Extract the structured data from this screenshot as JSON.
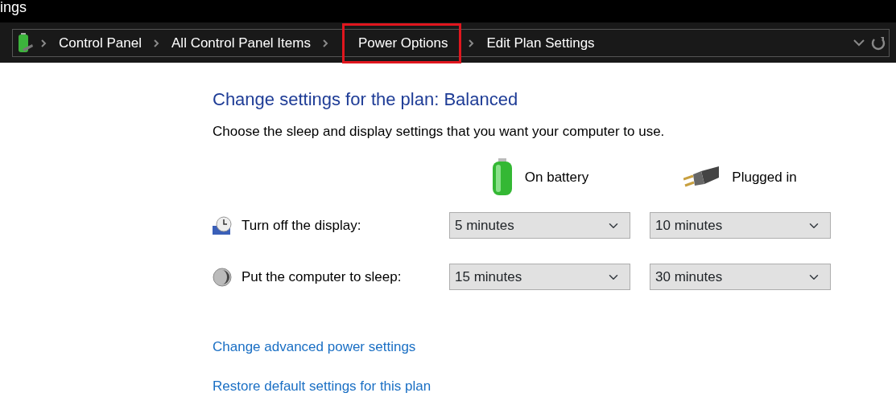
{
  "window": {
    "title": "ings"
  },
  "breadcrumb": [
    {
      "label": "Control Panel",
      "highlighted": false
    },
    {
      "label": "All Control Panel Items",
      "highlighted": false
    },
    {
      "label": "Power Options",
      "highlighted": true
    },
    {
      "label": "Edit Plan Settings",
      "highlighted": false
    }
  ],
  "heading": "Change settings for the plan: Balanced",
  "subheading": "Choose the sleep and display settings that you want your computer to use.",
  "columns": [
    {
      "kind": "battery",
      "label": "On battery"
    },
    {
      "kind": "plug",
      "label": "Plugged in"
    }
  ],
  "settings": [
    {
      "kind": "display",
      "label": "Turn off the display:",
      "values": [
        "5 minutes",
        "10 minutes"
      ]
    },
    {
      "kind": "sleep",
      "label": "Put the computer to sleep:",
      "values": [
        "15 minutes",
        "30 minutes"
      ]
    }
  ],
  "links": [
    "Change advanced power settings",
    "Restore default settings for this plan"
  ]
}
